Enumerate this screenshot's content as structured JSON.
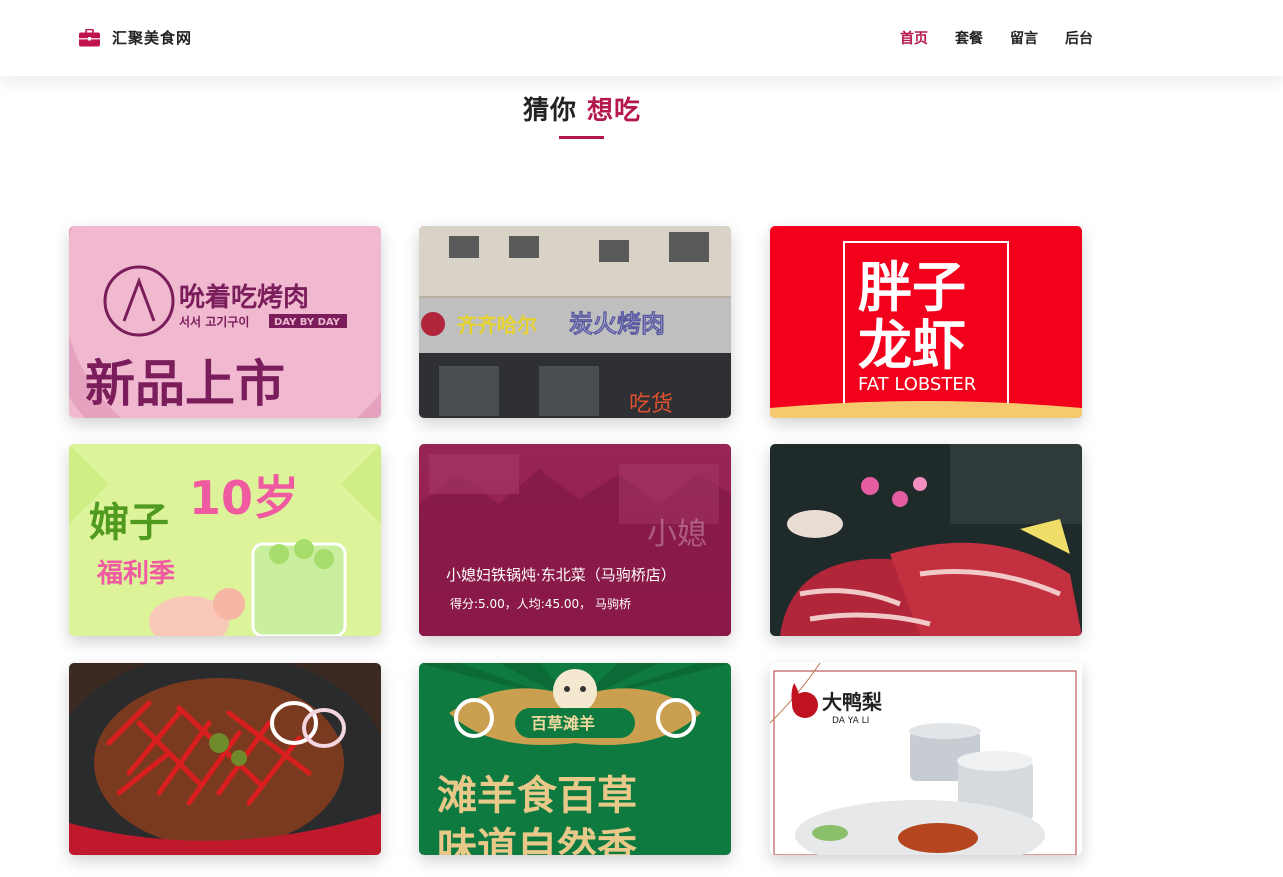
{
  "brand": {
    "name": "汇聚美食网",
    "icon": "briefcase-icon",
    "color": "#c0124f"
  },
  "nav": {
    "items": [
      {
        "label": "首页",
        "active": true
      },
      {
        "label": "套餐",
        "active": false
      },
      {
        "label": "留言",
        "active": false
      },
      {
        "label": "后台",
        "active": false
      }
    ]
  },
  "section": {
    "title_plain": "猜你 ",
    "title_accent": "想吃"
  },
  "cards": [
    {
      "art_lines": [
        "吮着吃烤肉",
        "서서 고기구이",
        "DAY BY DAY",
        "新品上市"
      ]
    },
    {
      "art_lines": [
        "齐齐哈尔",
        "炭火烤肉",
        "吃货"
      ]
    },
    {
      "art_lines": [
        "胖子",
        "龙虾",
        "FAT LOBSTER"
      ]
    },
    {
      "art_lines": [
        "婶子",
        "10岁",
        "福利季"
      ]
    },
    {
      "name": "小媳妇铁锅炖·东北菜（马驹桥店）",
      "meta": "得分:5.00，人均:45.00， 马驹桥",
      "art_lines": [
        "小媳"
      ]
    },
    {
      "art_lines": []
    },
    {
      "art_lines": []
    },
    {
      "art_lines": [
        "百草滩羊",
        "滩羊食百草",
        "味道自然香"
      ]
    },
    {
      "art_lines": [
        "大鸭梨",
        "DA YA LI"
      ]
    }
  ]
}
